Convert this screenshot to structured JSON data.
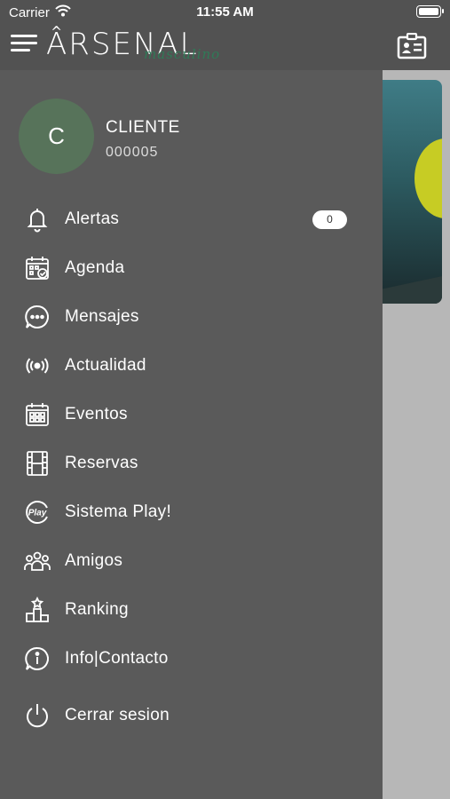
{
  "status_bar": {
    "carrier": "Carrier",
    "time": "11:55 AM"
  },
  "header": {
    "logo_text": "ÂRSENAL",
    "logo_script": "masculino",
    "menu_icon": "hamburger-icon",
    "card_icon": "id-card-icon"
  },
  "profile": {
    "initial": "C",
    "name": "CLIENTE",
    "code": "000005"
  },
  "menu": {
    "items": [
      {
        "label": "Alertas",
        "icon": "bell-icon",
        "badge": "0"
      },
      {
        "label": "Agenda",
        "icon": "calendar-check-icon"
      },
      {
        "label": "Mensajes",
        "icon": "chat-bubble-icon"
      },
      {
        "label": "Actualidad",
        "icon": "broadcast-icon"
      },
      {
        "label": "Eventos",
        "icon": "calendar-grid-icon"
      },
      {
        "label": "Reservas",
        "icon": "film-strip-icon"
      },
      {
        "label": "Sistema Play!",
        "icon": "play-badge-icon",
        "icon_text": "Play"
      },
      {
        "label": "Amigos",
        "icon": "friends-icon"
      },
      {
        "label": "Ranking",
        "icon": "podium-icon"
      },
      {
        "label": "Info|Contacto",
        "icon": "info-icon"
      },
      {
        "label": "Cerrar sesion",
        "icon": "power-icon"
      }
    ]
  },
  "colors": {
    "topbar": "#525252",
    "drawer": "#5a5a5a",
    "avatar": "#57735a",
    "logo_accent": "#2f7a57",
    "backdrop": "#b7b7b7"
  }
}
